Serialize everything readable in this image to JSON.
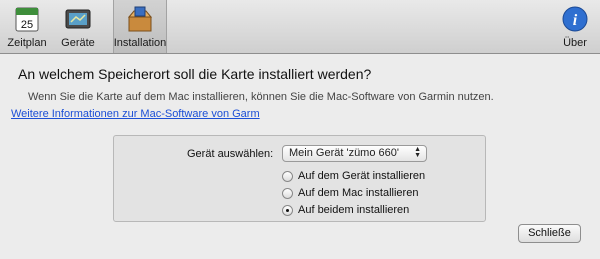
{
  "toolbar": {
    "items": [
      {
        "label": "Zeitplan",
        "icon": "calendar-icon",
        "calendar_day": "25"
      },
      {
        "label": "Geräte",
        "icon": "device-icon"
      },
      {
        "label": "Installation",
        "icon": "installation-icon"
      }
    ],
    "about": {
      "label": "Über",
      "icon": "info-icon",
      "glyph": "i"
    }
  },
  "main": {
    "question": "An welchem Speicherort soll die Karte installiert werden?",
    "description": "Wenn Sie die Karte auf dem Mac installieren, können Sie die Mac-Software von Garmin nutzen.",
    "link": "Weitere Informationen zur Mac-Software von Garm"
  },
  "panel": {
    "device_label": "Gerät auswählen:",
    "device_value": "Mein Gerät 'zümo 660'",
    "options": [
      {
        "label": "Auf dem Gerät installieren",
        "checked": false
      },
      {
        "label": "Auf dem Mac installieren",
        "checked": false
      },
      {
        "label": "Auf beidem installieren",
        "checked": true
      }
    ]
  },
  "close_label": "Schließe",
  "colors": {
    "link": "#1c4fd6",
    "info_blue": "#2f6fd0"
  }
}
